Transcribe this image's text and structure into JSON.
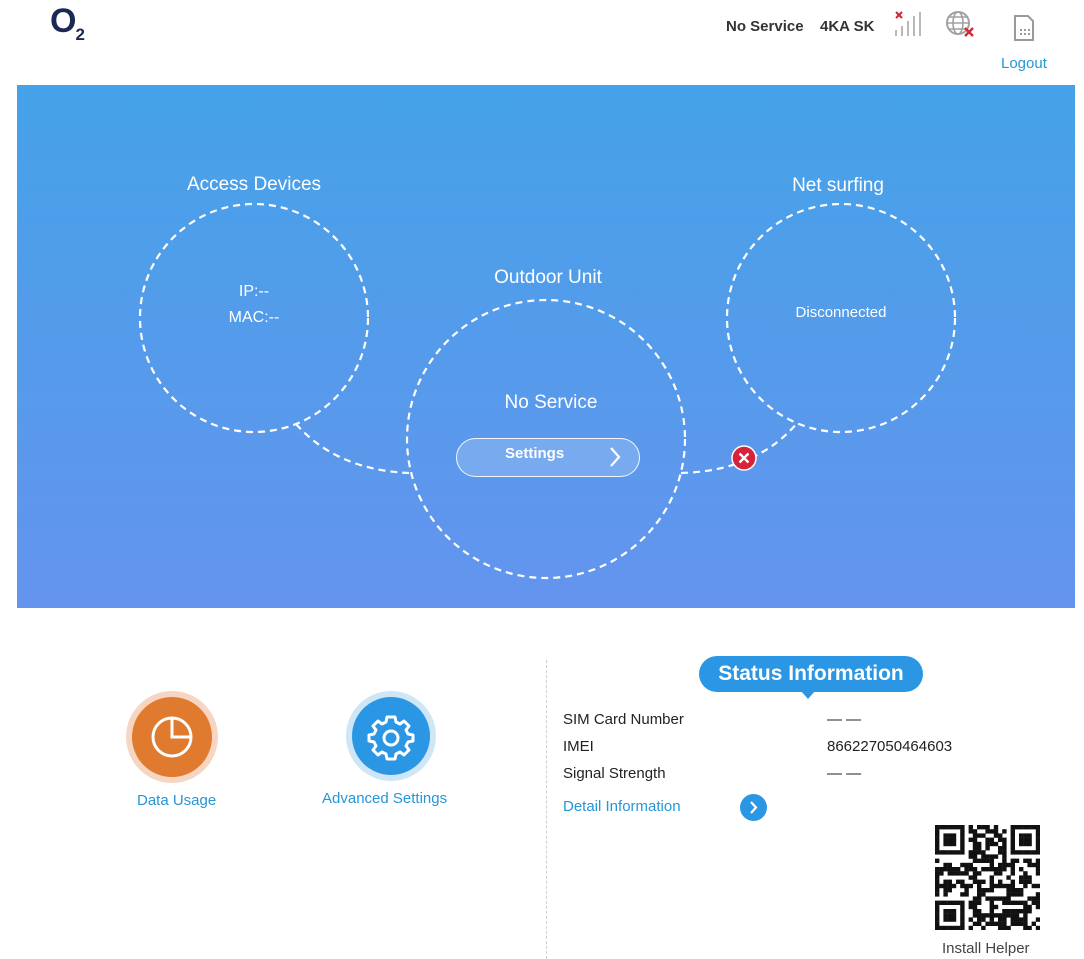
{
  "header": {
    "logo_text": "O",
    "logo_sub": "2",
    "network_status": "No Service",
    "operator": "4KA SK",
    "logout_label": "Logout",
    "icons": [
      "signal-strength-icon",
      "globe-disconnected-icon",
      "sim-card-icon"
    ]
  },
  "hero": {
    "access_devices": {
      "title": "Access Devices",
      "ip": "IP:--",
      "mac": "MAC:--"
    },
    "outdoor_unit": {
      "title": "Outdoor Unit",
      "status": "No Service",
      "settings_label": "Settings"
    },
    "net_surfing": {
      "title": "Net surfing",
      "status": "Disconnected"
    },
    "connection_state_icon": "error-x-icon"
  },
  "tiles": [
    {
      "label": "Data Usage",
      "icon": "pie-chart-icon",
      "color": "#e07a2e"
    },
    {
      "label": "Advanced Settings",
      "icon": "gear-icon",
      "color": "#2b96e3"
    }
  ],
  "status": {
    "title": "Status Information",
    "rows": [
      {
        "label": "SIM Card Number",
        "value": "— —"
      },
      {
        "label": "IMEI",
        "value": "866227050464603"
      },
      {
        "label": "Signal Strength",
        "value": "— —"
      }
    ],
    "detail_label": "Detail Information",
    "install_helper_label": "Install Helper"
  },
  "colors": {
    "accent": "#2b96e3",
    "hero_top": "#45a2e8",
    "hero_bottom": "#6494ee",
    "error": "#d4243a",
    "orange": "#e07a2e"
  }
}
